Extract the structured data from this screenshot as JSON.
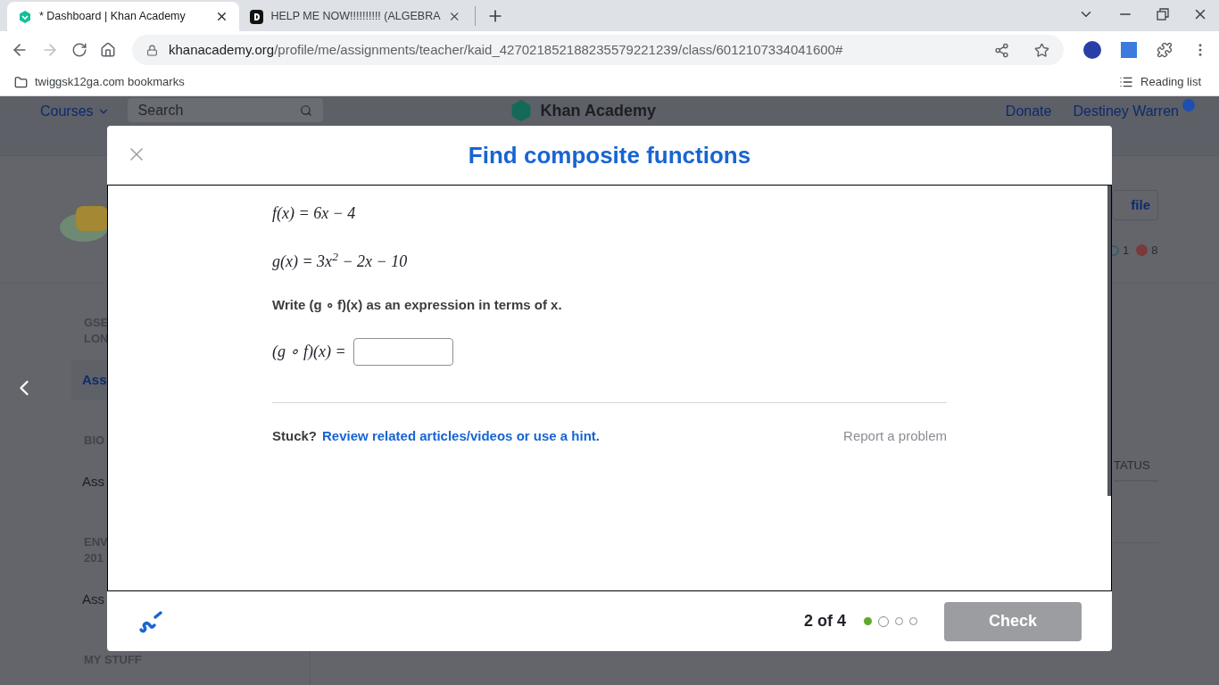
{
  "browser": {
    "tabs": [
      {
        "title": "* Dashboard | Khan Academy",
        "selected": true
      },
      {
        "title": "HELP ME NOW!!!!!!!!!! (ALGEBRA",
        "selected": false
      }
    ],
    "url_host": "khanacademy.org",
    "url_path": "/profile/me/assignments/teacher/kaid_427021852188235579221239/class/6012107334041600#",
    "bookmark": "twiggsk12ga.com bookmarks",
    "reading_list": "Reading list"
  },
  "background": {
    "courses": "Courses",
    "search_placeholder": "Search",
    "logo": "Khan Academy",
    "donate": "Donate",
    "user": "Destiney Warren",
    "profile_button": "file",
    "stats": [
      "1",
      "8"
    ],
    "sidebar": [
      {
        "kind": "heading",
        "lines": [
          "GSE",
          "LON"
        ]
      },
      {
        "kind": "link",
        "text": "Ass",
        "selected": true
      },
      {
        "kind": "heading",
        "lines": [
          "BIO"
        ]
      },
      {
        "kind": "link",
        "text": "Ass",
        "selected": false
      },
      {
        "kind": "heading",
        "lines": [
          "ENV",
          "201"
        ]
      },
      {
        "kind": "link",
        "text": "Ass",
        "selected": false
      },
      {
        "kind": "heading",
        "lines": [
          "MY STUFF"
        ]
      }
    ],
    "table_header": "TATUS"
  },
  "modal": {
    "title": "Find composite functions",
    "equations": [
      "f(x) = 6x − 4",
      "g(x) = 3x$^{2}$ − 2x − 10"
    ],
    "prompt": "Write (g ∘ f)(x) as an expression in terms of x.",
    "answer_label": "(g ∘ f)(x) =",
    "stuck": "Stuck?",
    "hint_link": "Review related articles/videos or use a hint.",
    "report": "Report a problem",
    "progress": "2 of 4",
    "dots": [
      {
        "kind": "correct"
      },
      {
        "kind": "current"
      },
      {
        "kind": "pending"
      },
      {
        "kind": "pending"
      }
    ],
    "check": {
      "label": "Check",
      "disabled": true
    }
  }
}
